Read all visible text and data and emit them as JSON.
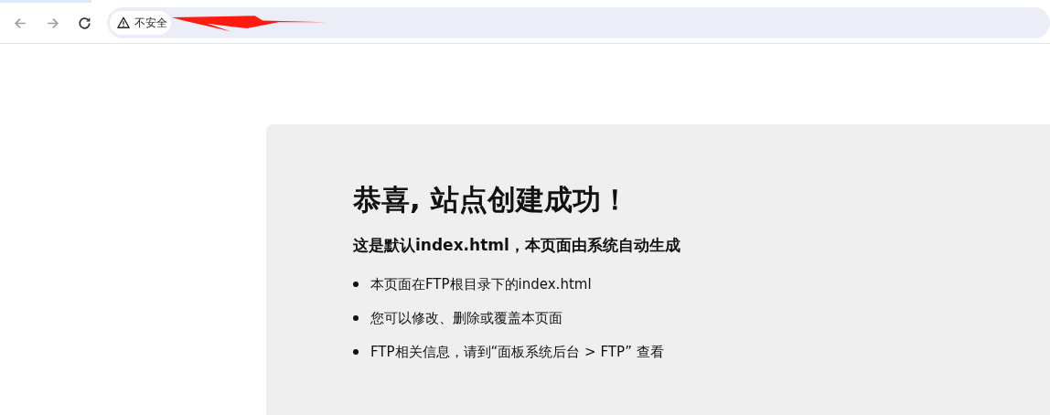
{
  "browser": {
    "security_label": "不安全"
  },
  "page": {
    "title": "恭喜, 站点创建成功！",
    "subtitle": "这是默认index.html，本页面由系统自动生成",
    "items": [
      "本页面在FTP根目录下的index.html",
      "您可以修改、删除或覆盖本页面",
      "FTP相关信息，请到“面板系统后台 > FTP” 查看"
    ]
  }
}
